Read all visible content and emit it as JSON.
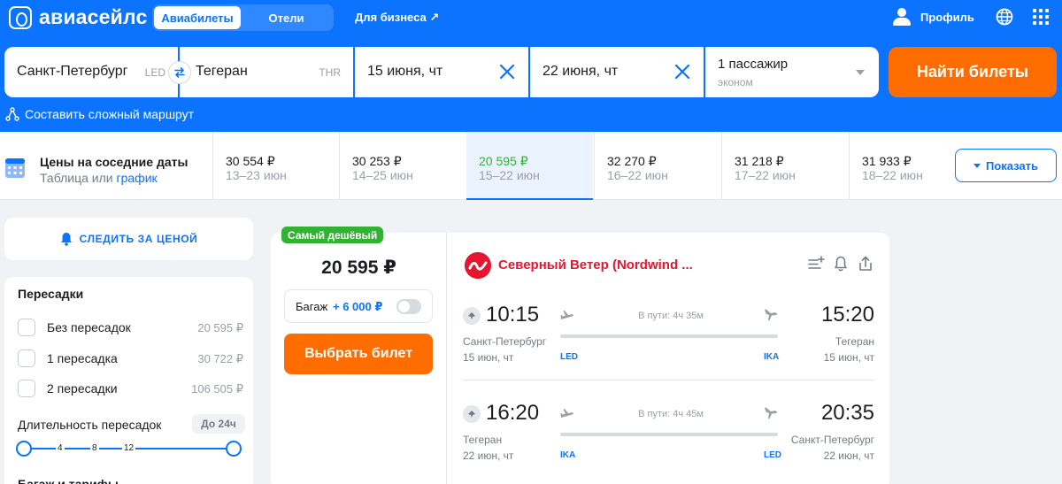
{
  "header": {
    "logo_text": "авиасейлс",
    "tabs": [
      {
        "label": "Авиабилеты",
        "active": true
      },
      {
        "label": "Отели",
        "active": false
      }
    ],
    "business_link": "Для бизнеса ↗",
    "profile_label": "Профиль",
    "accent_color": "#0c73fe"
  },
  "search": {
    "origin": {
      "city": "Санкт-Петербург",
      "code": "LED"
    },
    "destination": {
      "city": "Тегеран",
      "code": "THR"
    },
    "depart_date": "15 июня, чт",
    "return_date": "22 июня, чт",
    "passengers": "1 пассажир",
    "cabin_class": "эконом",
    "find_button": "Найти билеты",
    "complex_route": "Составить сложный маршрут",
    "find_button_color": "#ff6d00"
  },
  "nearby_dates": {
    "title": "Цены на соседние даты",
    "sub_table": "Таблица",
    "sub_or": "или",
    "sub_chart": "график",
    "cells": [
      {
        "price": "30 554 ₽",
        "range": "13–23 июн",
        "active": false
      },
      {
        "price": "30 253 ₽",
        "range": "14–25 июн",
        "active": false
      },
      {
        "price": "20 595 ₽",
        "range": "15–22 июн",
        "active": true
      },
      {
        "price": "32 270 ₽",
        "range": "16–22 июн",
        "active": false
      },
      {
        "price": "31 218 ₽",
        "range": "17–22 июн",
        "active": false
      },
      {
        "price": "31 933 ₽",
        "range": "18–22 июн",
        "active": false
      }
    ],
    "show_button": "Показать"
  },
  "sidebar": {
    "watch_price": "СЛЕДИТЬ ЗА ЦЕНОЙ",
    "stops_title": "Пересадки",
    "stops": [
      {
        "label": "Без пересадок",
        "price": "20 595 ₽"
      },
      {
        "label": "1 пересадка",
        "price": "30 722 ₽"
      },
      {
        "label": "2 пересадки",
        "price": "106 505 ₽"
      }
    ],
    "duration_label": "Длительность пересадок",
    "duration_badge": "До 24ч",
    "slider_ticks": [
      "4",
      "8",
      "12"
    ],
    "next_section": "Багаж и тарифы"
  },
  "ticket": {
    "badge": "Самый дешёвый",
    "price": "20 595 ₽",
    "baggage_label": "Багаж",
    "baggage_price": "+ 6 000 ₽",
    "select_button": "Выбрать билет",
    "airline": "Северный Ветер (Nordwind ...",
    "airline_color": "#e5162f",
    "segments": [
      {
        "dep_time": "10:15",
        "arr_time": "15:20",
        "duration": "В пути: 4ч 35м",
        "dep_city": "Санкт-Петербург",
        "arr_city": "Тегеран",
        "dep_date": "15 июн, чт",
        "arr_date": "15 июн, чт",
        "dep_code": "LED",
        "arr_code": "IKA"
      },
      {
        "dep_time": "16:20",
        "arr_time": "20:35",
        "duration": "В пути: 4ч 45м",
        "dep_city": "Тегеран",
        "arr_city": "Санкт-Петербург",
        "dep_date": "22 июн, чт",
        "arr_date": "22 июн, чт",
        "dep_code": "IKA",
        "arr_code": "LED"
      }
    ]
  }
}
